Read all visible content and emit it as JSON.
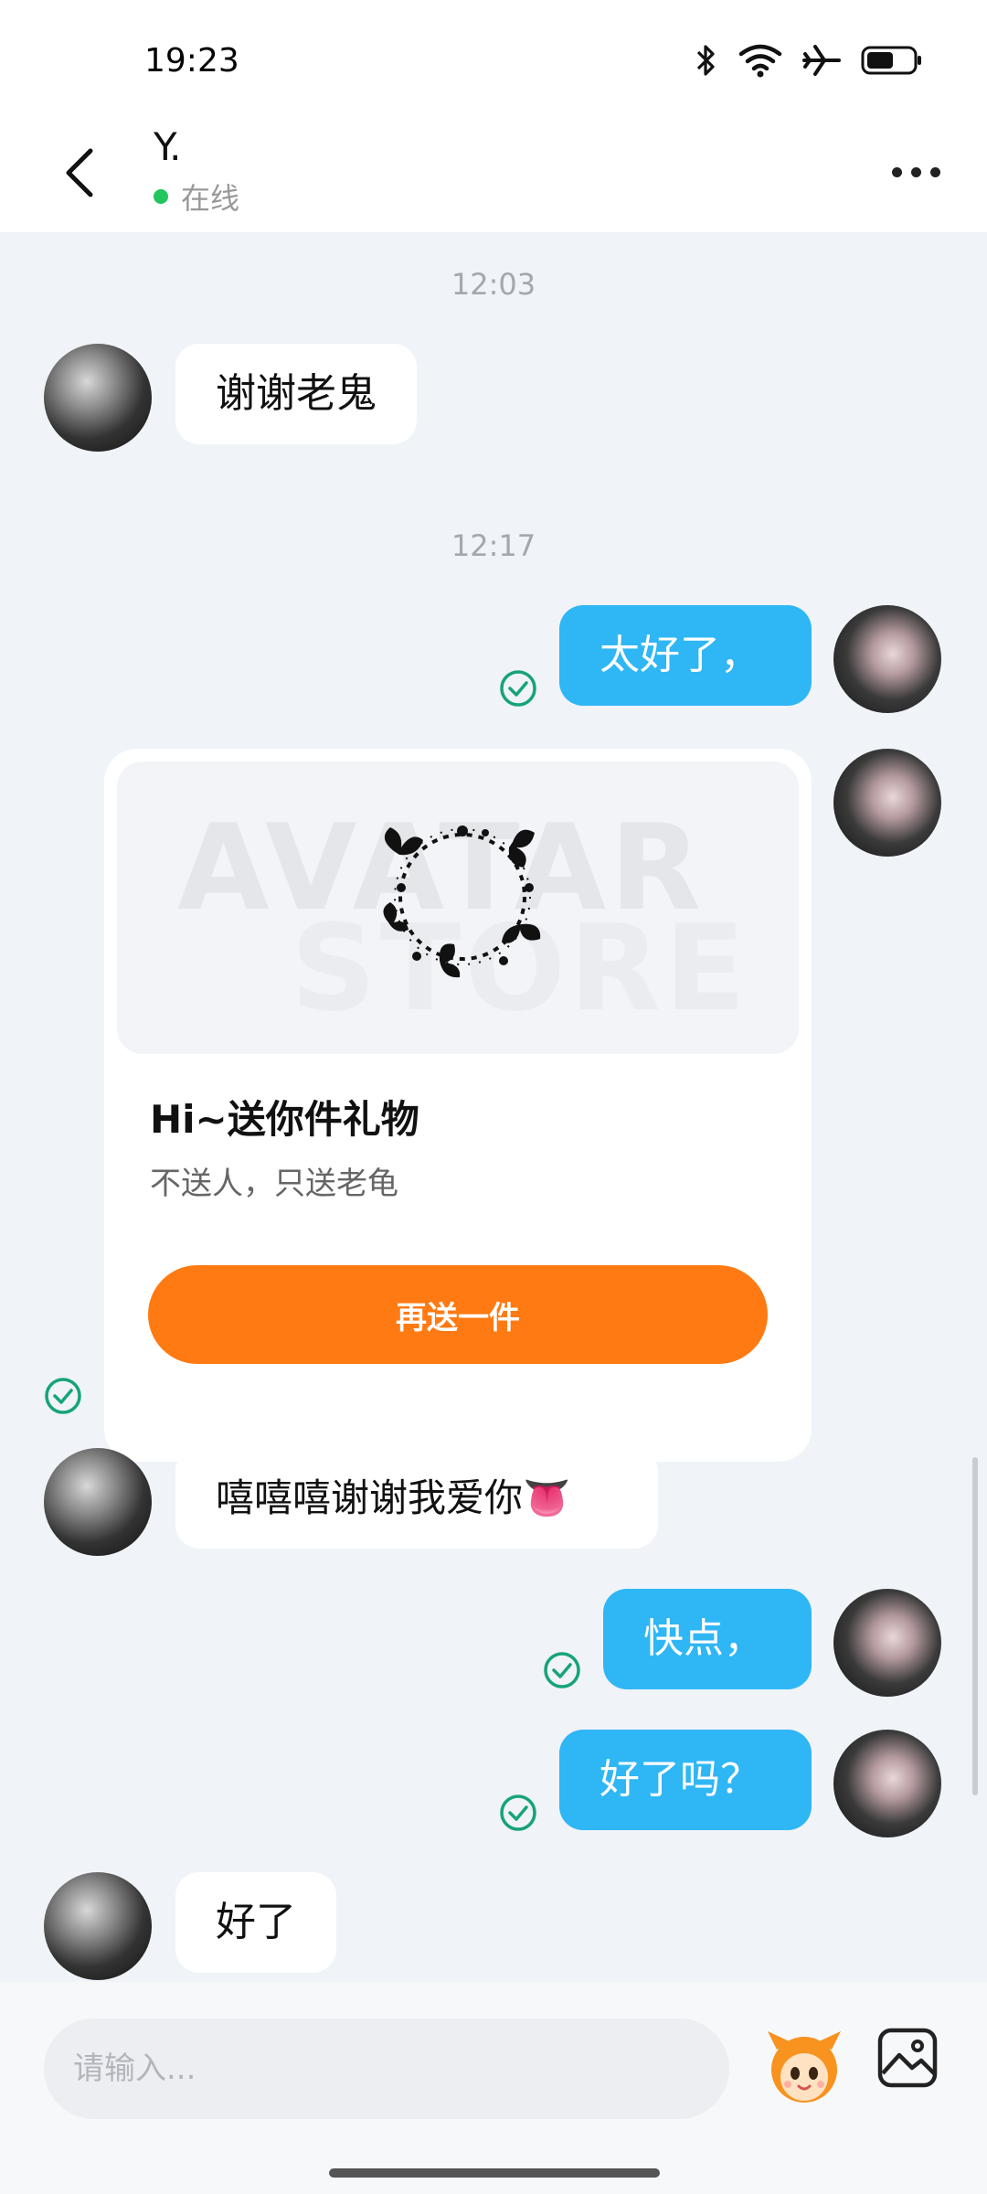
{
  "status_bar": {
    "time": "19:23",
    "icons": [
      "bluetooth-icon",
      "wifi-icon",
      "airplane-icon",
      "battery-icon"
    ]
  },
  "header": {
    "contact_name": "Y.",
    "presence": "在线",
    "presence_color": "#22c55e"
  },
  "messages": {
    "ts1": "12:03",
    "m1": "谢谢老鬼",
    "ts2": "12:17",
    "m2": "太好了，",
    "gift": {
      "title": "Hi~送你件礼物",
      "subtitle": "不送人，只送老龟",
      "button": "再送一件",
      "watermark_line1": "AVATAR",
      "watermark_line2": "STORE"
    },
    "m3": "嘻嘻嘻谢谢我爱你👅",
    "m4": "快点，",
    "m5": "好了吗？",
    "m6": "好了"
  },
  "input": {
    "placeholder": "请输入..."
  },
  "colors": {
    "outgoing_bubble": "#2fb6f5",
    "incoming_bubble": "#ffffff",
    "accent_button": "#ff7a12",
    "read_check": "#16a37a"
  }
}
